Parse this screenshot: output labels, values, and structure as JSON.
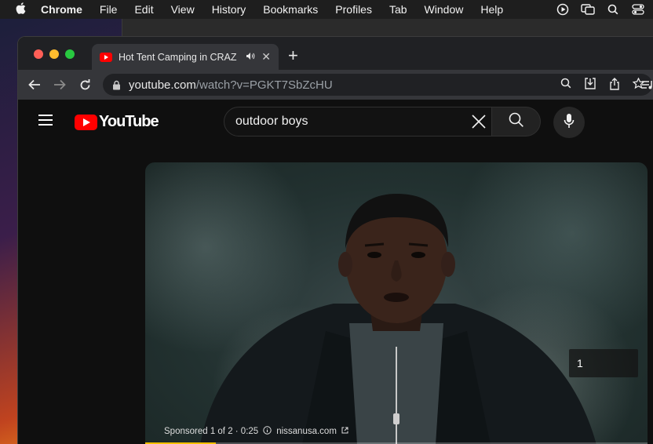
{
  "menubar": {
    "app": "Chrome",
    "items": [
      "File",
      "Edit",
      "View",
      "History",
      "Bookmarks",
      "Profiles",
      "Tab",
      "Window",
      "Help"
    ]
  },
  "tab": {
    "title": "Hot Tent Camping in CRAZ"
  },
  "address": {
    "host": "youtube.com",
    "path": "/watch?v=PGKT7SbZcHU"
  },
  "youtube": {
    "logo_text": "YouTube",
    "search_value": "outdoor boys"
  },
  "ad": {
    "skip_count": "1",
    "sponsored": "Sponsored 1 of 2 · 0:25",
    "advertiser": "nissanusa.com",
    "progress": 0.14
  },
  "colors": {
    "yt_red": "#ff0000",
    "ad_progress": "#f6c000",
    "light_close": "#ff5f57",
    "light_min": "#febc2e",
    "light_max": "#28c840"
  }
}
